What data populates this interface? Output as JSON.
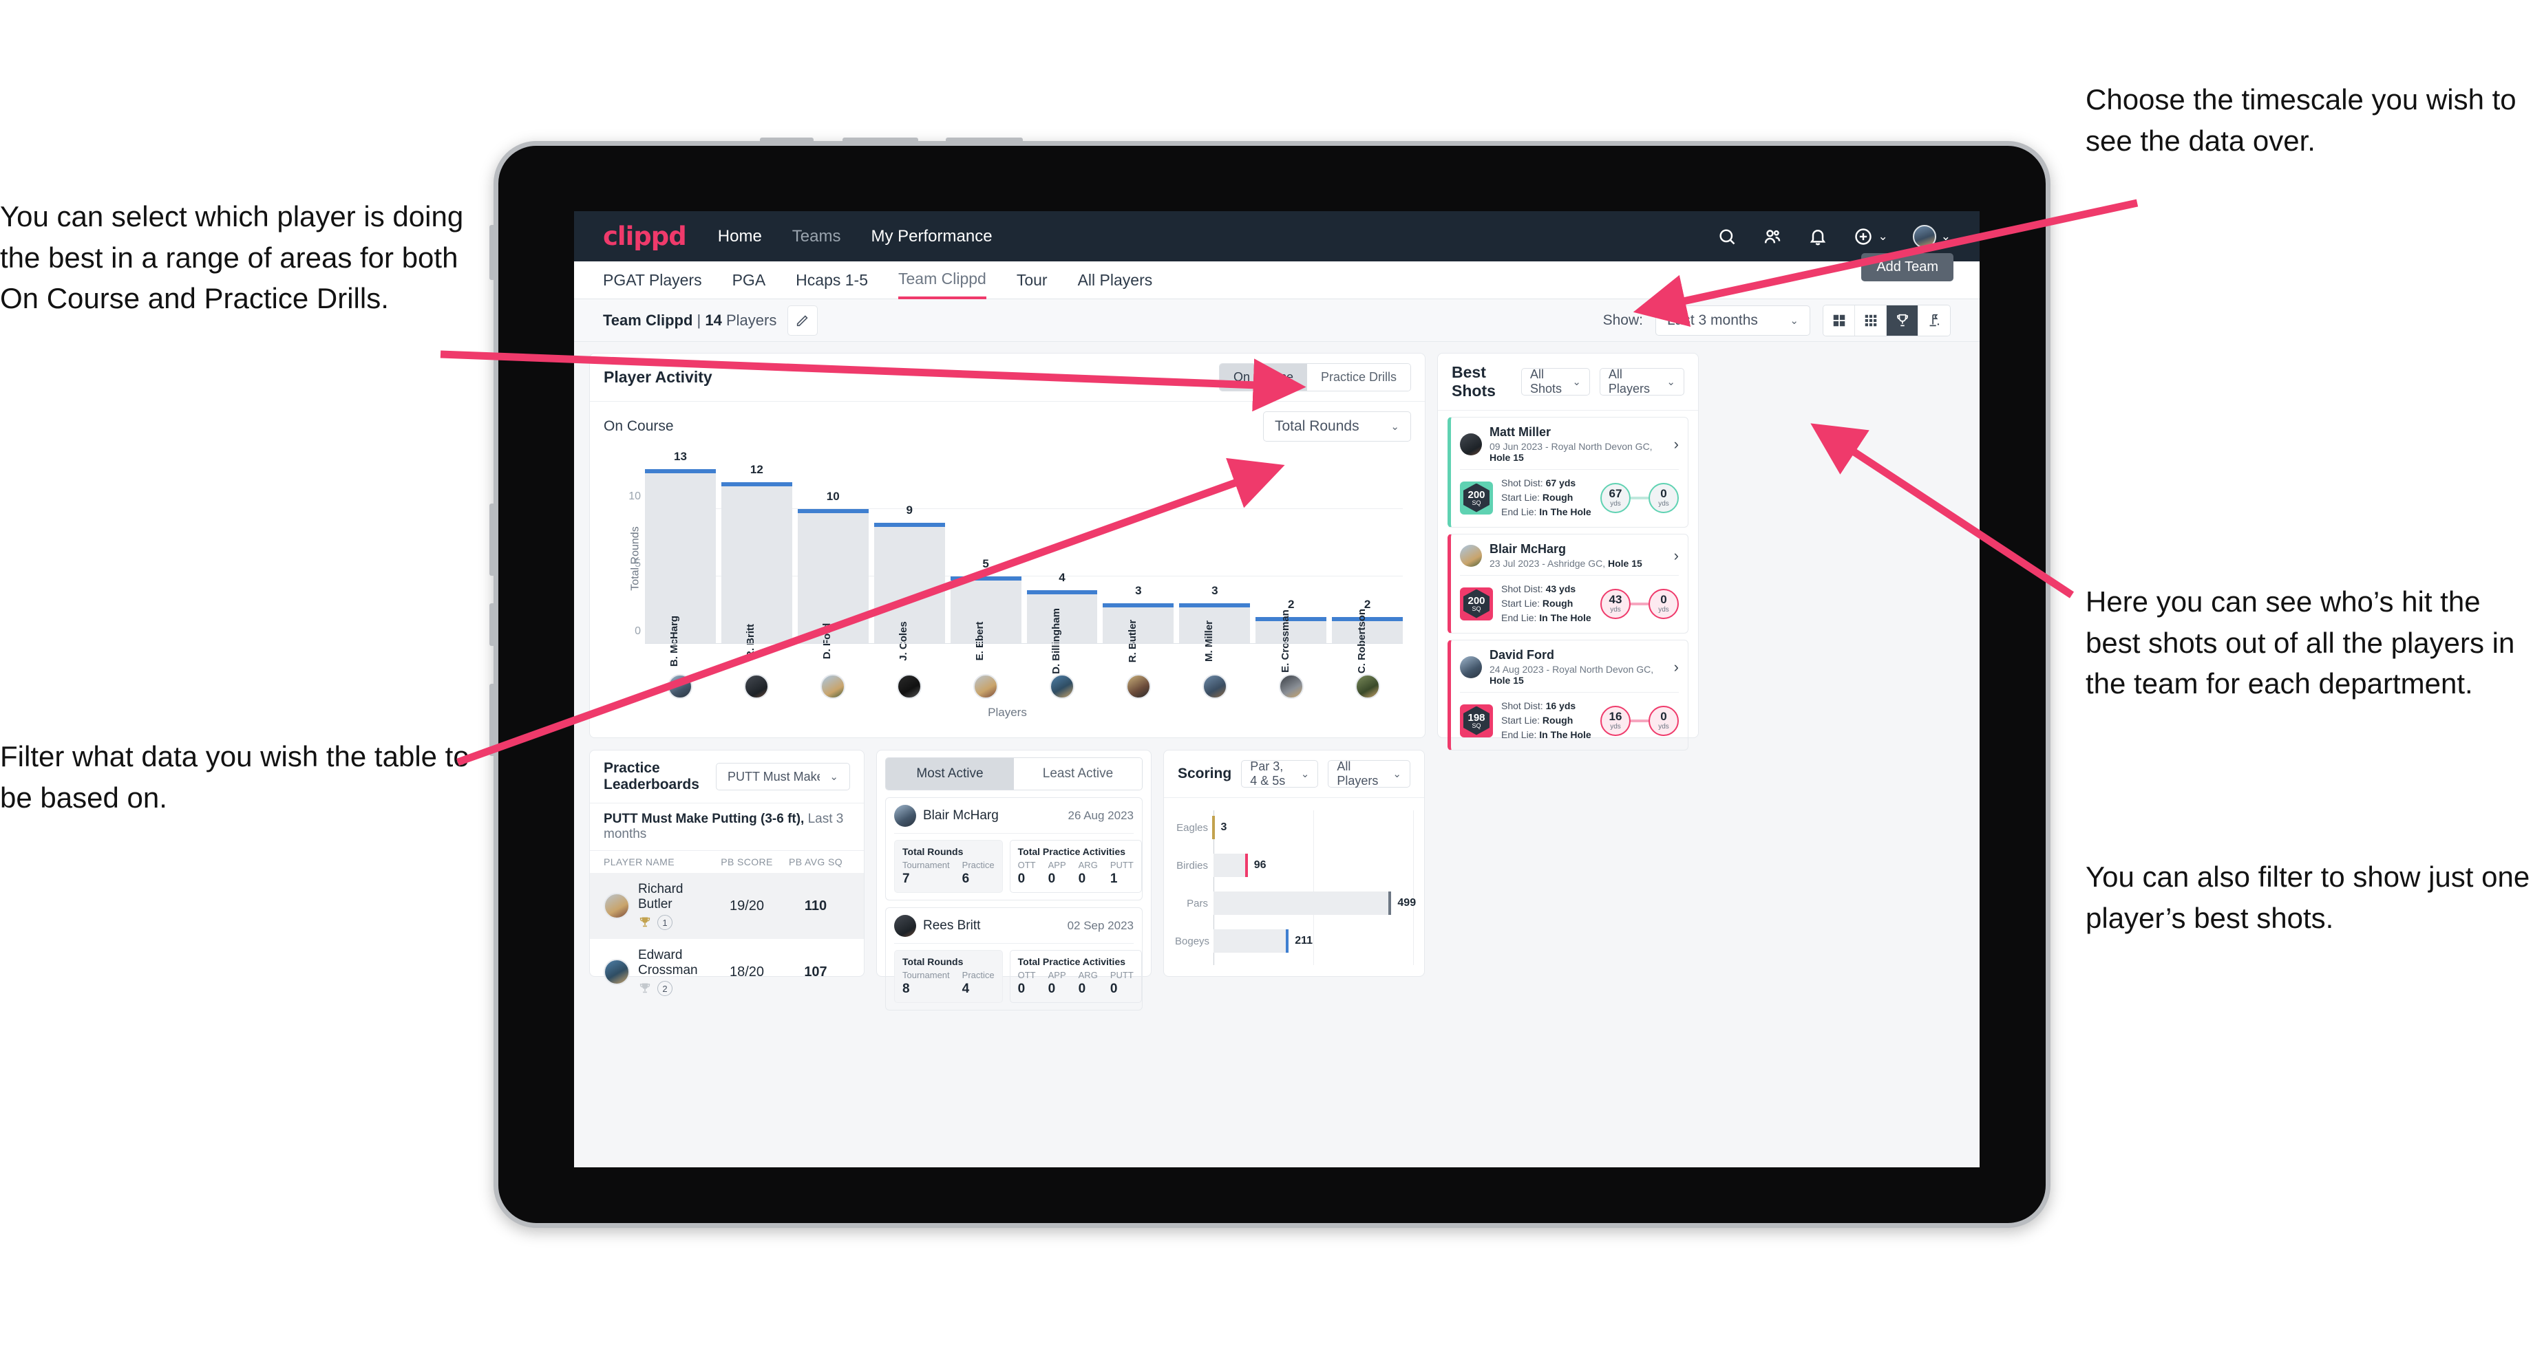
{
  "annotations": {
    "left_top": "You can select which player is doing the best in a range of areas for both On Course and Practice Drills.",
    "left_bottom": "Filter what data you wish the table to be based on.",
    "right_top": "Choose the timescale you wish to see the data over.",
    "right_middle": "Here you can see who’s hit the best shots out of all the players in the team for each department.",
    "right_bottom": "You can also filter to show just one player’s best shots."
  },
  "topnav": {
    "brand": "clippd",
    "links": [
      {
        "label": "Home",
        "active": true
      },
      {
        "label": "Teams",
        "active": false
      },
      {
        "label": "My Performance",
        "active": true
      }
    ],
    "icons": [
      "search-icon",
      "people-icon",
      "bell-icon",
      "plus-circle-icon",
      "avatar"
    ]
  },
  "tabs": {
    "items": [
      {
        "label": "PGAT Players",
        "active": false
      },
      {
        "label": "PGA",
        "active": false
      },
      {
        "label": "Hcaps 1-5",
        "active": false
      },
      {
        "label": "Team Clippd",
        "active": true
      },
      {
        "label": "Tour",
        "active": false
      },
      {
        "label": "All Players",
        "active": false
      }
    ],
    "tooltip": "Add Team"
  },
  "subheader": {
    "team_name": "Team Clippd",
    "separator": "|",
    "player_count": "14",
    "players_word": "Players",
    "edit_icon": "pencil-icon",
    "show_label": "Show:",
    "period_value": "Last 3 months",
    "view_icons": [
      "grid-large-icon",
      "grid-small-icon",
      "trophy-icon",
      "flag-icon"
    ],
    "active_view": "trophy-icon"
  },
  "player_activity": {
    "title": "Player Activity",
    "segments": [
      {
        "label": "On Course",
        "active": true
      },
      {
        "label": "Practice Drills",
        "active": false
      }
    ],
    "sub_label": "On Course",
    "metric_value": "Total Rounds"
  },
  "best_shots": {
    "title": "Best Shots",
    "filter_shots": "All Shots",
    "filter_players": "All Players",
    "items": [
      {
        "player": "Matt Miller",
        "meta_date": "09 Jun 2023 - Royal North Devon GC,",
        "meta_hole": "Hole 15",
        "badge_number": "200",
        "badge_unit": "SQ",
        "accent": "teal",
        "shot_dist_label": "Shot Dist:",
        "shot_dist_value": "67 yds",
        "start_lie_label": "Start Lie:",
        "start_lie_value": "Rough",
        "end_lie_label": "End Lie:",
        "end_lie_value": "In The Hole",
        "from_value": "67",
        "from_unit": "yds",
        "to_value": "0",
        "to_unit": "yds"
      },
      {
        "player": "Blair McHarg",
        "meta_date": "23 Jul 2023 - Ashridge GC,",
        "meta_hole": "Hole 15",
        "badge_number": "200",
        "badge_unit": "SQ",
        "accent": "pink",
        "shot_dist_label": "Shot Dist:",
        "shot_dist_value": "43 yds",
        "start_lie_label": "Start Lie:",
        "start_lie_value": "Rough",
        "end_lie_label": "End Lie:",
        "end_lie_value": "In The Hole",
        "from_value": "43",
        "from_unit": "yds",
        "to_value": "0",
        "to_unit": "yds"
      },
      {
        "player": "David Ford",
        "meta_date": "24 Aug 2023 - Royal North Devon GC,",
        "meta_hole": "Hole 15",
        "badge_number": "198",
        "badge_unit": "SQ",
        "accent": "pink",
        "shot_dist_label": "Shot Dist:",
        "shot_dist_value": "16 yds",
        "start_lie_label": "Start Lie:",
        "start_lie_value": "Rough",
        "end_lie_label": "End Lie:",
        "end_lie_value": "In The Hole",
        "from_value": "16",
        "from_unit": "yds",
        "to_value": "0",
        "to_unit": "yds"
      }
    ]
  },
  "practice_leaderboards": {
    "title": "Practice Leaderboards",
    "selector_value": "PUTT Must Make Putting ...",
    "subtitle_bold": "PUTT Must Make Putting (3-6 ft),",
    "subtitle_rest": "Last 3 months",
    "columns": [
      "PLAYER NAME",
      "PB SCORE",
      "PB AVG SQ"
    ],
    "rows": [
      {
        "name": "Richard Butler",
        "rank": "1",
        "trophy": "gold",
        "pb_score": "19/20",
        "pb_avg_sq": "110",
        "highlight": true
      },
      {
        "name": "Edward Crossman",
        "rank": "2",
        "trophy": "silver",
        "pb_score": "18/20",
        "pb_avg_sq": "107",
        "highlight": false
      }
    ]
  },
  "activity_panel": {
    "tabs": [
      {
        "label": "Most Active",
        "active": true
      },
      {
        "label": "Least Active",
        "active": false
      }
    ],
    "items": [
      {
        "name": "Blair McHarg",
        "date": "26 Aug 2023",
        "rounds_title": "Total Rounds",
        "rounds": [
          {
            "key": "Tournament",
            "value": "7"
          },
          {
            "key": "Practice",
            "value": "6"
          }
        ],
        "practice_title": "Total Practice Activities",
        "practice": [
          {
            "key": "OTT",
            "value": "0"
          },
          {
            "key": "APP",
            "value": "0"
          },
          {
            "key": "ARG",
            "value": "0"
          },
          {
            "key": "PUTT",
            "value": "1"
          }
        ]
      },
      {
        "name": "Rees Britt",
        "date": "02 Sep 2023",
        "rounds_title": "Total Rounds",
        "rounds": [
          {
            "key": "Tournament",
            "value": "8"
          },
          {
            "key": "Practice",
            "value": "4"
          }
        ],
        "practice_title": "Total Practice Activities",
        "practice": [
          {
            "key": "OTT",
            "value": "0"
          },
          {
            "key": "APP",
            "value": "0"
          },
          {
            "key": "ARG",
            "value": "0"
          },
          {
            "key": "PUTT",
            "value": "0"
          }
        ]
      }
    ]
  },
  "scoring": {
    "title": "Scoring",
    "filter_par": "Par 3, 4 & 5s",
    "filter_players": "All Players"
  },
  "colors": {
    "brand_pink": "#ef3a6b",
    "navy": "#1d2834",
    "bar_blue": "#3f7fd0",
    "teal": "#5fd2b2",
    "bar_gray": "#e4e7eb",
    "gold": "#c2a24e"
  },
  "chart_data": [
    {
      "type": "bar",
      "title": "Player Activity",
      "xlabel": "Players",
      "ylabel": "Total Rounds",
      "ylim": [
        0,
        14
      ],
      "yticks": [
        0,
        5,
        10
      ],
      "grid": true,
      "categories": [
        "B. McHarg",
        "R. Britt",
        "D. Ford",
        "J. Coles",
        "E. Ebert",
        "D. Billingham",
        "R. Butler",
        "M. Miller",
        "E. Crossman",
        "C. Robertson"
      ],
      "values": [
        13,
        12,
        10,
        9,
        5,
        4,
        3,
        3,
        2,
        2
      ]
    },
    {
      "type": "bar",
      "orientation": "horizontal",
      "title": "Scoring",
      "xlabel": "",
      "ylabel": "",
      "grid": true,
      "categories": [
        "Eagles",
        "Birdies",
        "Pars",
        "Bogeys"
      ],
      "values": [
        3,
        96,
        499,
        211
      ],
      "xlim": [
        0,
        560
      ],
      "tip_colors": [
        "#c2a24e",
        "#ef3a6b",
        "#6d7784",
        "#3f7fd0"
      ]
    }
  ]
}
